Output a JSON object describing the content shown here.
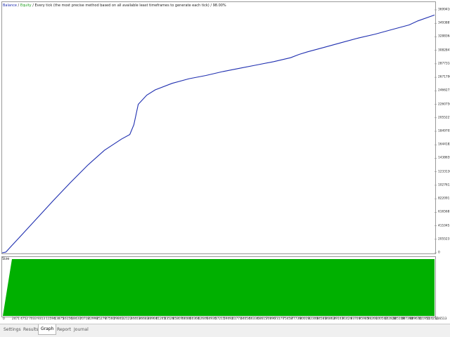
{
  "header": {
    "balance_label": "Balance",
    "separator1": " / ",
    "equity_label": "Equity",
    "description": " / Every tick (the most precise method based on all available least timeframes to generate each tick) / 98.00%"
  },
  "y_axis_labels": [
    "3699410",
    "3493887",
    "3288364",
    "3082841",
    "2877318",
    "2671796",
    "2466273",
    "2260750",
    "2055227",
    "1849705",
    "1644182",
    "1438659",
    "1233136",
    "1027613",
    "822091",
    "616568",
    "411045",
    "205523",
    "0"
  ],
  "size_panel": {
    "label": "Size"
  },
  "x_axis_labels": [
    "0",
    "2471",
    "4752",
    "7033",
    "9313",
    "11594",
    "13875",
    "16156",
    "18437",
    "20718",
    "22998",
    "25279",
    "27560",
    "29841",
    "32122",
    "34403",
    "36683",
    "38964",
    "41245",
    "43526",
    "45807",
    "48088",
    "50368",
    "52649",
    "54930",
    "57211",
    "59492",
    "61773",
    "64054",
    "66334",
    "68615",
    "70896",
    "73177",
    "75458",
    "77739",
    "80019",
    "82300",
    "84581",
    "86862",
    "89143",
    "91424",
    "93704",
    "95985",
    "98266",
    "100547",
    "102828",
    "105109",
    "107390",
    "109670",
    "111951",
    "114232",
    "116513"
  ],
  "tabs": [
    {
      "label": "Settings",
      "active": false
    },
    {
      "label": "Results",
      "active": false
    },
    {
      "label": "Graph",
      "active": true
    },
    {
      "label": "Report",
      "active": false
    },
    {
      "label": "Journal",
      "active": false
    }
  ],
  "colors": {
    "balance": "#1f2fb0",
    "equity": "#1e9e1e",
    "size_fill": "#00b000",
    "grid": "#c8c8c8"
  },
  "chart_data": {
    "type": "line",
    "title": "",
    "xlabel": "",
    "ylabel": "",
    "x_range": [
      0,
      116513
    ],
    "y_range": [
      0,
      3699410
    ],
    "series": [
      {
        "name": "Balance",
        "x": [
          0,
          1000,
          2471,
          4752,
          9313,
          13875,
          18437,
          22998,
          27560,
          32122,
          34403,
          35500,
          36683,
          38964,
          41245,
          45807,
          50368,
          54930,
          59492,
          64054,
          68615,
          73177,
          77739,
          80019,
          82300,
          86862,
          91424,
          95985,
          100547,
          105109,
          109670,
          112000,
          116513
        ],
        "y": [
          0,
          10000,
          100000,
          240000,
          520000,
          800000,
          1070000,
          1330000,
          1560000,
          1730000,
          1800000,
          1950000,
          2260000,
          2400000,
          2480000,
          2580000,
          2650000,
          2700000,
          2760000,
          2810000,
          2860000,
          2910000,
          2970000,
          3020000,
          3060000,
          3130000,
          3200000,
          3270000,
          3330000,
          3400000,
          3470000,
          3530000,
          3620000
        ]
      },
      {
        "name": "Size",
        "x": [
          0,
          2471,
          116513
        ],
        "y": [
          0,
          1,
          1
        ]
      }
    ]
  }
}
